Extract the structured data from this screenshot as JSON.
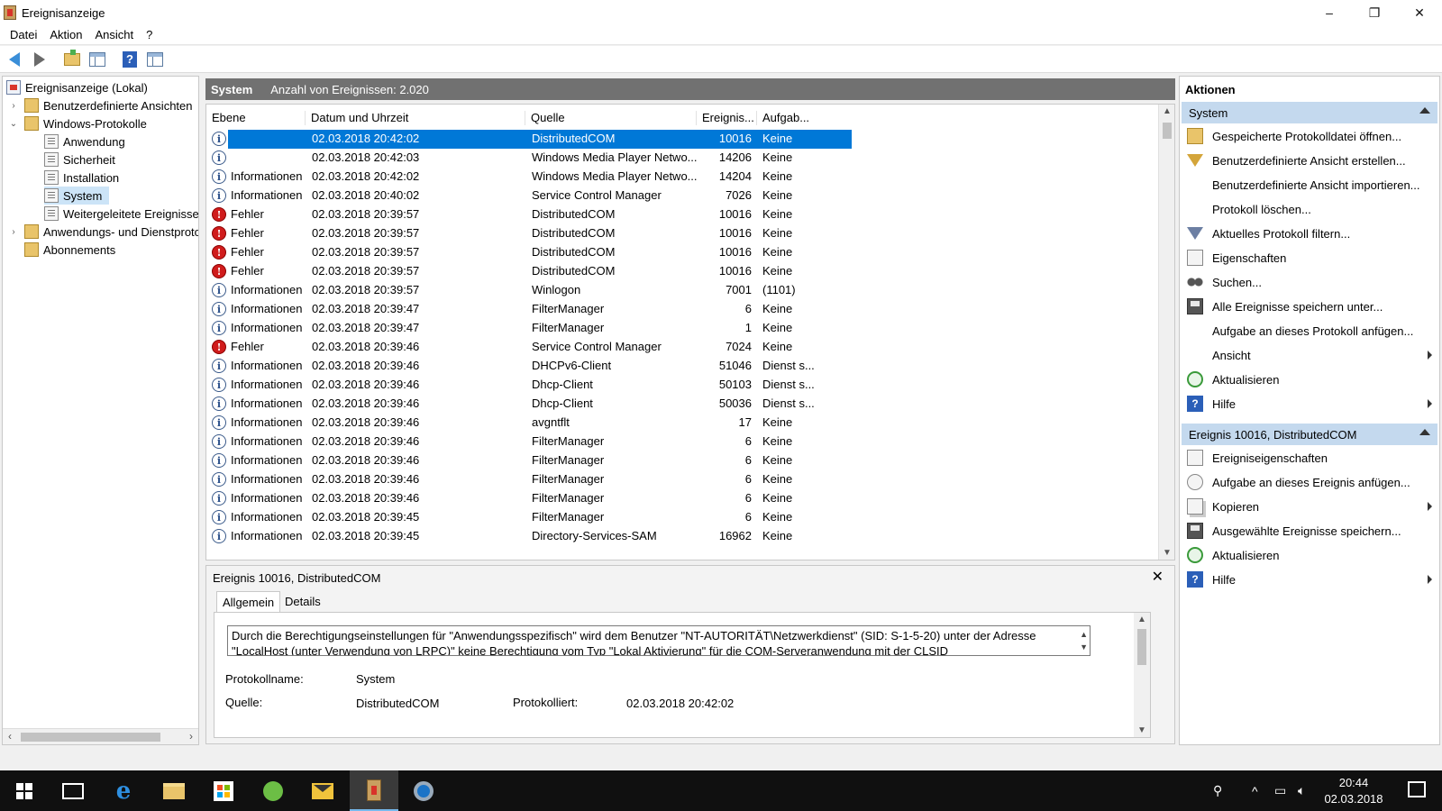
{
  "window": {
    "title": "Ereignisanzeige",
    "controls": {
      "minimize": "–",
      "maximize": "❐",
      "close": "✕"
    }
  },
  "menu": [
    "Datei",
    "Aktion",
    "Ansicht",
    "?"
  ],
  "tree": [
    {
      "label": "Ereignisanzeige (Lokal)",
      "icon": "event-viewer-icon",
      "toggle": ""
    },
    {
      "label": "Benutzerdefinierte Ansichten",
      "icon": "folder-icon",
      "toggle": "›"
    },
    {
      "label": "Windows-Protokolle",
      "icon": "folder-icon",
      "toggle": "⌄"
    },
    {
      "label": "Anwendung",
      "icon": "log-icon",
      "toggle": ""
    },
    {
      "label": "Sicherheit",
      "icon": "log-icon",
      "toggle": ""
    },
    {
      "label": "Installation",
      "icon": "log-icon",
      "toggle": ""
    },
    {
      "label": "System",
      "icon": "log-icon",
      "toggle": ""
    },
    {
      "label": "Weitergeleitete Ereignisse",
      "icon": "log-icon",
      "toggle": ""
    },
    {
      "label": "Anwendungs- und Dienstprotokolle",
      "icon": "folder-icon",
      "toggle": "›"
    },
    {
      "label": "Abonnements",
      "icon": "folder-icon",
      "toggle": ""
    }
  ],
  "center": {
    "log_name": "System",
    "event_count": "Anzahl von Ereignissen: 2.020"
  },
  "columns": [
    "Ebene",
    "Datum und Uhrzeit",
    "Quelle",
    "Ereignis...",
    "Aufgab..."
  ],
  "events": [
    {
      "level": "Informationen",
      "type": "info",
      "date": "02.03.2018 20:42:02",
      "source": "DistributedCOM",
      "id": "10016",
      "task": "Keine",
      "selected": true
    },
    {
      "level": "",
      "type": "info",
      "date": "02.03.2018 20:42:03",
      "source": "Windows Media Player Netwo...",
      "id": "14206",
      "task": "Keine"
    },
    {
      "level": "Informationen",
      "type": "info",
      "date": "02.03.2018 20:42:02",
      "source": "Windows Media Player Netwo...",
      "id": "14204",
      "task": "Keine"
    },
    {
      "level": "Informationen",
      "type": "info",
      "date": "02.03.2018 20:40:02",
      "source": "Service Control Manager",
      "id": "7026",
      "task": "Keine"
    },
    {
      "level": "Fehler",
      "type": "error",
      "date": "02.03.2018 20:39:57",
      "source": "DistributedCOM",
      "id": "10016",
      "task": "Keine"
    },
    {
      "level": "Fehler",
      "type": "error",
      "date": "02.03.2018 20:39:57",
      "source": "DistributedCOM",
      "id": "10016",
      "task": "Keine"
    },
    {
      "level": "Fehler",
      "type": "error",
      "date": "02.03.2018 20:39:57",
      "source": "DistributedCOM",
      "id": "10016",
      "task": "Keine"
    },
    {
      "level": "Fehler",
      "type": "error",
      "date": "02.03.2018 20:39:57",
      "source": "DistributedCOM",
      "id": "10016",
      "task": "Keine"
    },
    {
      "level": "Informationen",
      "type": "info",
      "date": "02.03.2018 20:39:57",
      "source": "Winlogon",
      "id": "7001",
      "task": "(1101)"
    },
    {
      "level": "Informationen",
      "type": "info",
      "date": "02.03.2018 20:39:47",
      "source": "FilterManager",
      "id": "6",
      "task": "Keine"
    },
    {
      "level": "Informationen",
      "type": "info",
      "date": "02.03.2018 20:39:47",
      "source": "FilterManager",
      "id": "1",
      "task": "Keine"
    },
    {
      "level": "Fehler",
      "type": "error",
      "date": "02.03.2018 20:39:46",
      "source": "Service Control Manager",
      "id": "7024",
      "task": "Keine"
    },
    {
      "level": "Informationen",
      "type": "info",
      "date": "02.03.2018 20:39:46",
      "source": "DHCPv6-Client",
      "id": "51046",
      "task": "Dienst s..."
    },
    {
      "level": "Informationen",
      "type": "info",
      "date": "02.03.2018 20:39:46",
      "source": "Dhcp-Client",
      "id": "50103",
      "task": "Dienst s..."
    },
    {
      "level": "Informationen",
      "type": "info",
      "date": "02.03.2018 20:39:46",
      "source": "Dhcp-Client",
      "id": "50036",
      "task": "Dienst s..."
    },
    {
      "level": "Informationen",
      "type": "info",
      "date": "02.03.2018 20:39:46",
      "source": "avgntflt",
      "id": "17",
      "task": "Keine"
    },
    {
      "level": "Informationen",
      "type": "info",
      "date": "02.03.2018 20:39:46",
      "source": "FilterManager",
      "id": "6",
      "task": "Keine"
    },
    {
      "level": "Informationen",
      "type": "info",
      "date": "02.03.2018 20:39:46",
      "source": "FilterManager",
      "id": "6",
      "task": "Keine"
    },
    {
      "level": "Informationen",
      "type": "info",
      "date": "02.03.2018 20:39:46",
      "source": "FilterManager",
      "id": "6",
      "task": "Keine"
    },
    {
      "level": "Informationen",
      "type": "info",
      "date": "02.03.2018 20:39:46",
      "source": "FilterManager",
      "id": "6",
      "task": "Keine"
    },
    {
      "level": "Informationen",
      "type": "info",
      "date": "02.03.2018 20:39:45",
      "source": "FilterManager",
      "id": "6",
      "task": "Keine"
    },
    {
      "level": "Informationen",
      "type": "info",
      "date": "02.03.2018 20:39:45",
      "source": "Directory-Services-SAM",
      "id": "16962",
      "task": "Keine"
    }
  ],
  "detail": {
    "title": "Ereignis 10016, DistributedCOM",
    "close": "✕",
    "tabs": [
      "Allgemein",
      "Details"
    ],
    "description": "Durch die Berechtigungseinstellungen für \"Anwendungsspezifisch\" wird dem Benutzer \"NT-AUTORITÄT\\Netzwerkdienst\" (SID: S-1-5-20) unter der Adresse \"LocalHost (unter Verwendung von LRPC)\" keine Berechtigung vom Typ \"Lokal Aktivierung\" für die COM-Serveranwendung mit der CLSID",
    "labels": {
      "logname": "Protokollname:",
      "source": "Quelle:",
      "logged": "Protokolliert:"
    },
    "values": {
      "logname": "System",
      "source": "DistributedCOM",
      "logged": "02.03.2018 20:42:02"
    }
  },
  "actions": {
    "title": "Aktionen",
    "sections": [
      {
        "header": "System",
        "items": [
          {
            "label": "Gespeicherte Protokolldatei öffnen...",
            "icon": "open-log-icon",
            "sub": false
          },
          {
            "label": "Benutzerdefinierte Ansicht erstellen...",
            "icon": "create-view-icon",
            "sub": false
          },
          {
            "label": "Benutzerdefinierte Ansicht importieren...",
            "icon": "",
            "sub": false
          },
          {
            "label": "Protokoll löschen...",
            "icon": "",
            "sub": false
          },
          {
            "label": "Aktuelles Protokoll filtern...",
            "icon": "filter-icon",
            "sub": false
          },
          {
            "label": "Eigenschaften",
            "icon": "properties-icon",
            "sub": false
          },
          {
            "label": "Suchen...",
            "icon": "find-icon",
            "sub": false
          },
          {
            "label": "Alle Ereignisse speichern unter...",
            "icon": "save-icon",
            "sub": false
          },
          {
            "label": "Aufgabe an dieses Protokoll anfügen...",
            "icon": "",
            "sub": false
          },
          {
            "label": "Ansicht",
            "icon": "",
            "sub": true
          },
          {
            "label": "Aktualisieren",
            "icon": "refresh-icon",
            "sub": false
          },
          {
            "label": "Hilfe",
            "icon": "help-icon",
            "sub": true
          }
        ]
      },
      {
        "header": "Ereignis 10016, DistributedCOM",
        "items": [
          {
            "label": "Ereigniseigenschaften",
            "icon": "properties-icon",
            "sub": false
          },
          {
            "label": "Aufgabe an dieses Ereignis anfügen...",
            "icon": "task-icon",
            "sub": false
          },
          {
            "label": "Kopieren",
            "icon": "copy-icon",
            "sub": true
          },
          {
            "label": "Ausgewählte Ereignisse speichern...",
            "icon": "save-icon",
            "sub": false
          },
          {
            "label": "Aktualisieren",
            "icon": "refresh-icon",
            "sub": false
          },
          {
            "label": "Hilfe",
            "icon": "help-icon",
            "sub": true
          }
        ]
      }
    ]
  },
  "taskbar": {
    "time": "20:44",
    "date": "02.03.2018",
    "tray_up": "^"
  },
  "colors": {
    "selection": "#0078d7",
    "section_header": "#c4d9ee",
    "center_header": "#717171",
    "error": "#d01c1c"
  }
}
